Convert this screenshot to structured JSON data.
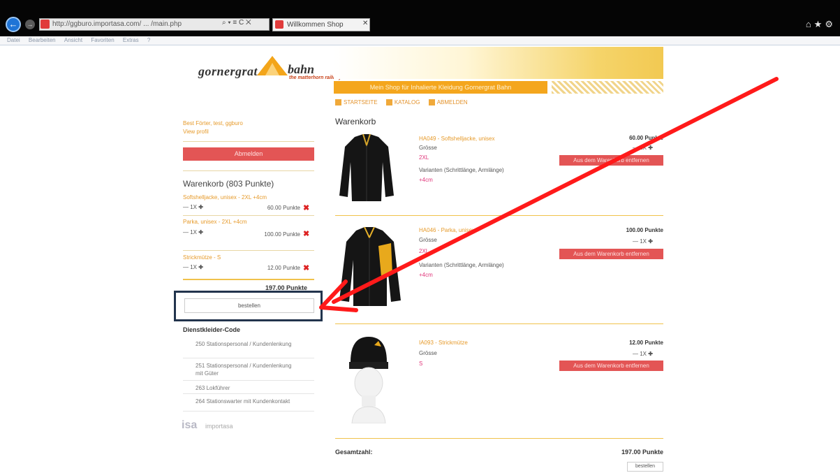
{
  "browser": {
    "url": "http://ggburo.importasa.com/ ... /main.php",
    "addr_controls": "⌕ ▾ ≡ C ✕",
    "tab_title": "Willkommen Shop",
    "tab_close": "✕",
    "right_icons": "⌂★⚙",
    "menu": [
      "Datei",
      "Bearbeiten",
      "Ansicht",
      "Favoriten",
      "Extras",
      "?"
    ]
  },
  "brand": {
    "name_left": "gornergrat",
    "name_right": "bahn",
    "tagline": "the matterhorn railway",
    "banner_text": "Mein Shop für Inhalierte Kleidung Gornergrat Bahn"
  },
  "nav": [
    "STARTSEITE",
    "KATALOG",
    "ABMELDEN"
  ],
  "sidebar": {
    "user": "Best Förter, test, ggburo",
    "view_profile": "View profil",
    "logout": "Abmelden",
    "cart_title": "Warenkorb (803 Punkte)",
    "cart_items": [
      {
        "name": "Softshelljacke, unisex - 2XL +4cm",
        "qty": "1X",
        "points": "60.00 Punkte"
      },
      {
        "name": "Parka, unisex - 2XL +4cm",
        "qty": "1X",
        "points": "100.00 Punkte"
      },
      {
        "name": "Strickmütze - S",
        "qty": "1X",
        "points": "12.00 Punkte"
      }
    ],
    "total": "197.00 Punkte",
    "order": "bestellen",
    "code_title": "Dienstkleider-Code",
    "codes": [
      "250 Stationspersonal / Kundenlenkung",
      "251 Stationspersonal / Kundenlenkung mit Güter",
      "263 Lokführer",
      "264 Stationswarter mit Kundenkontakt"
    ],
    "footer_logo": "isa",
    "footer_text": "importasa"
  },
  "main": {
    "title": "Warenkorb",
    "products": [
      {
        "name": "HA049 - Softshelljacke, unisex",
        "size_label": "Grösse",
        "size": "2XL",
        "variant_label": "Varianten (Schrittlänge, Armlänge)",
        "variant": "+4cm",
        "price": "60.00 Punkte",
        "qty": "1X",
        "remove": "Aus dem Warenkorb entfernen"
      },
      {
        "name": "HA046 - Parka, unisex",
        "size_label": "Grösse",
        "size": "2XL",
        "variant_label": "Varianten (Schrittlänge, Armlänge)",
        "variant": "+4cm",
        "price": "100.00 Punkte",
        "qty": "1X",
        "remove": "Aus dem Warenkorb entfernen"
      },
      {
        "name": "IA093 - Strickmütze",
        "size_label": "Grösse",
        "size": "S",
        "price": "12.00 Punkte",
        "qty": "1X",
        "remove": "Aus dem Warenkorb entfernen"
      }
    ],
    "total_label": "Gesamtzahl:",
    "total": "197.00 Punkte",
    "order": "bestellen"
  },
  "colors": {
    "accent": "#f4a61d",
    "danger": "#e35555",
    "highlight": "#22344d",
    "arrow": "#ff1a1a"
  }
}
